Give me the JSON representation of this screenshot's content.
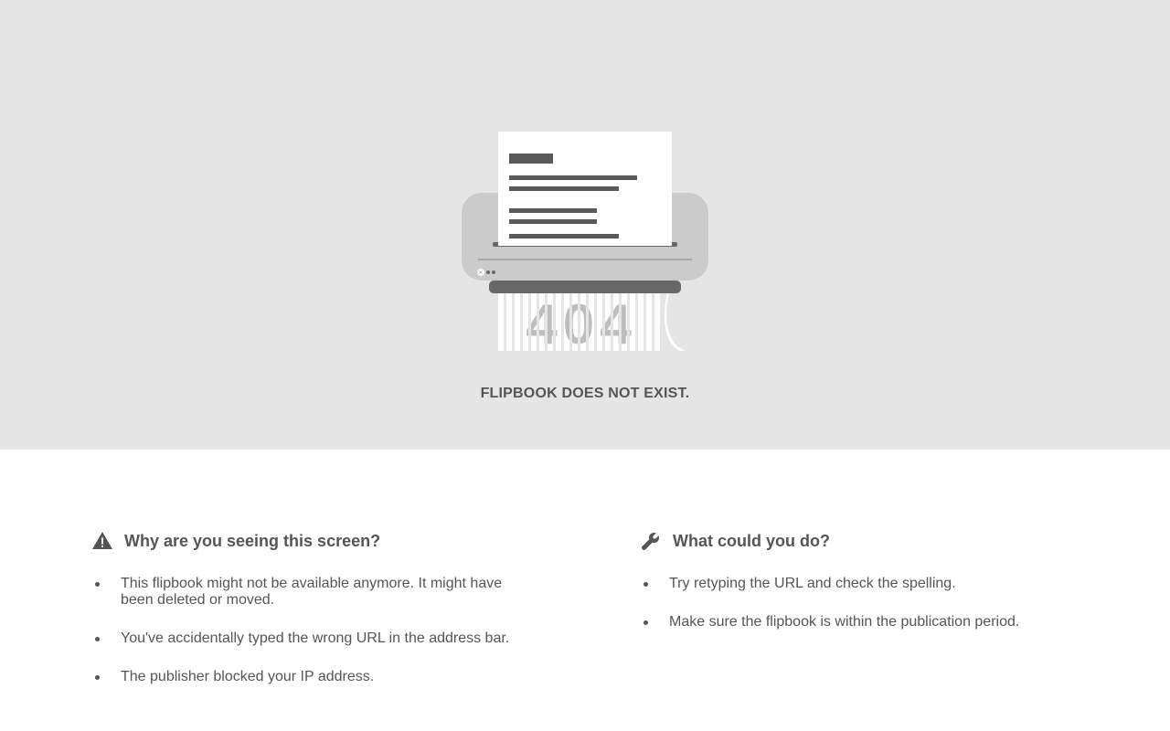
{
  "illustration": {
    "code_text": "404"
  },
  "error_message": "FLIPBOOK DOES NOT EXIST.",
  "why": {
    "title": "Why are you seeing this screen?",
    "icon": "warning-icon",
    "items": [
      "This flipbook might not be available anymore. It might have been deleted or moved.",
      "You've accidentally typed the wrong URL in the address bar.",
      "The publisher blocked your IP address."
    ]
  },
  "what": {
    "title": "What could you do?",
    "icon": "wrench-icon",
    "items": [
      "Try retyping the URL and check the spelling.",
      "Make sure the flipbook is within the publication period."
    ]
  },
  "colors": {
    "hero_background": "#e5e5e5",
    "shredder_body": "#cbcbcb",
    "shredder_dark": "#676767",
    "text": "#555555"
  }
}
